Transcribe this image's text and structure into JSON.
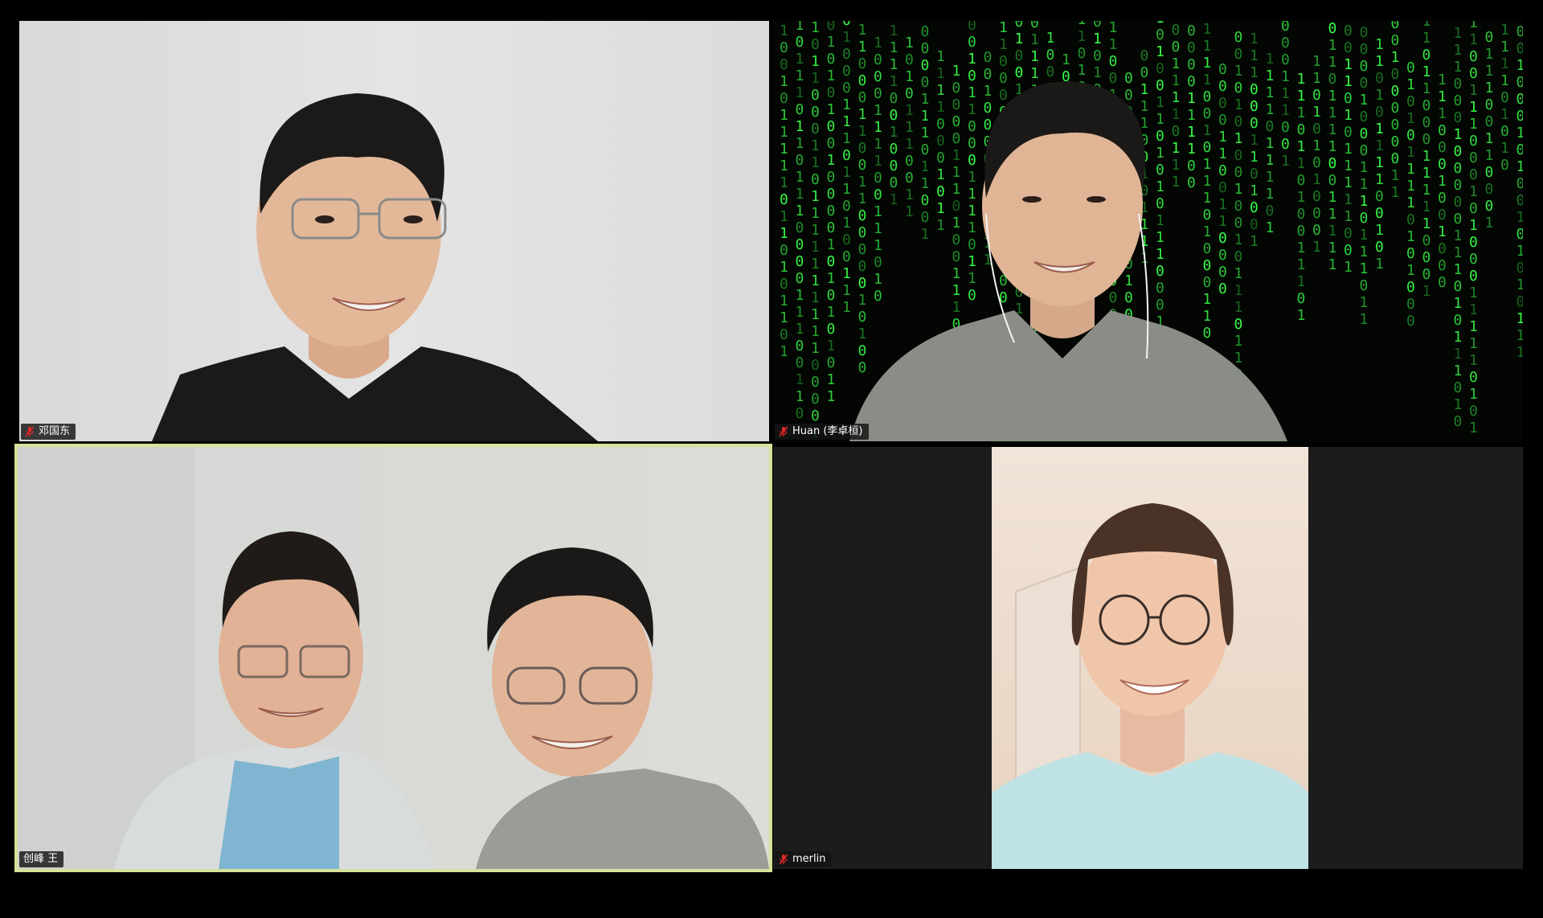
{
  "meeting": {
    "layout": "gallery-2x2",
    "active_speaker_border_color": "#d6e39a",
    "participants": [
      {
        "name": "邓国东",
        "muted": true,
        "mic_icon": "mic-muted-icon"
      },
      {
        "name": "Huan (李卓桓)",
        "muted": true,
        "mic_icon": "mic-muted-icon",
        "virtual_background": "matrix-code"
      },
      {
        "name": "创峰 王",
        "muted": false,
        "active_speaker": true
      },
      {
        "name": "merlin",
        "muted": true,
        "mic_icon": "mic-muted-icon"
      }
    ]
  },
  "colors": {
    "mute_red": "#e02828",
    "matrix_green": "#39ff4a",
    "tag_background": "#141414"
  }
}
